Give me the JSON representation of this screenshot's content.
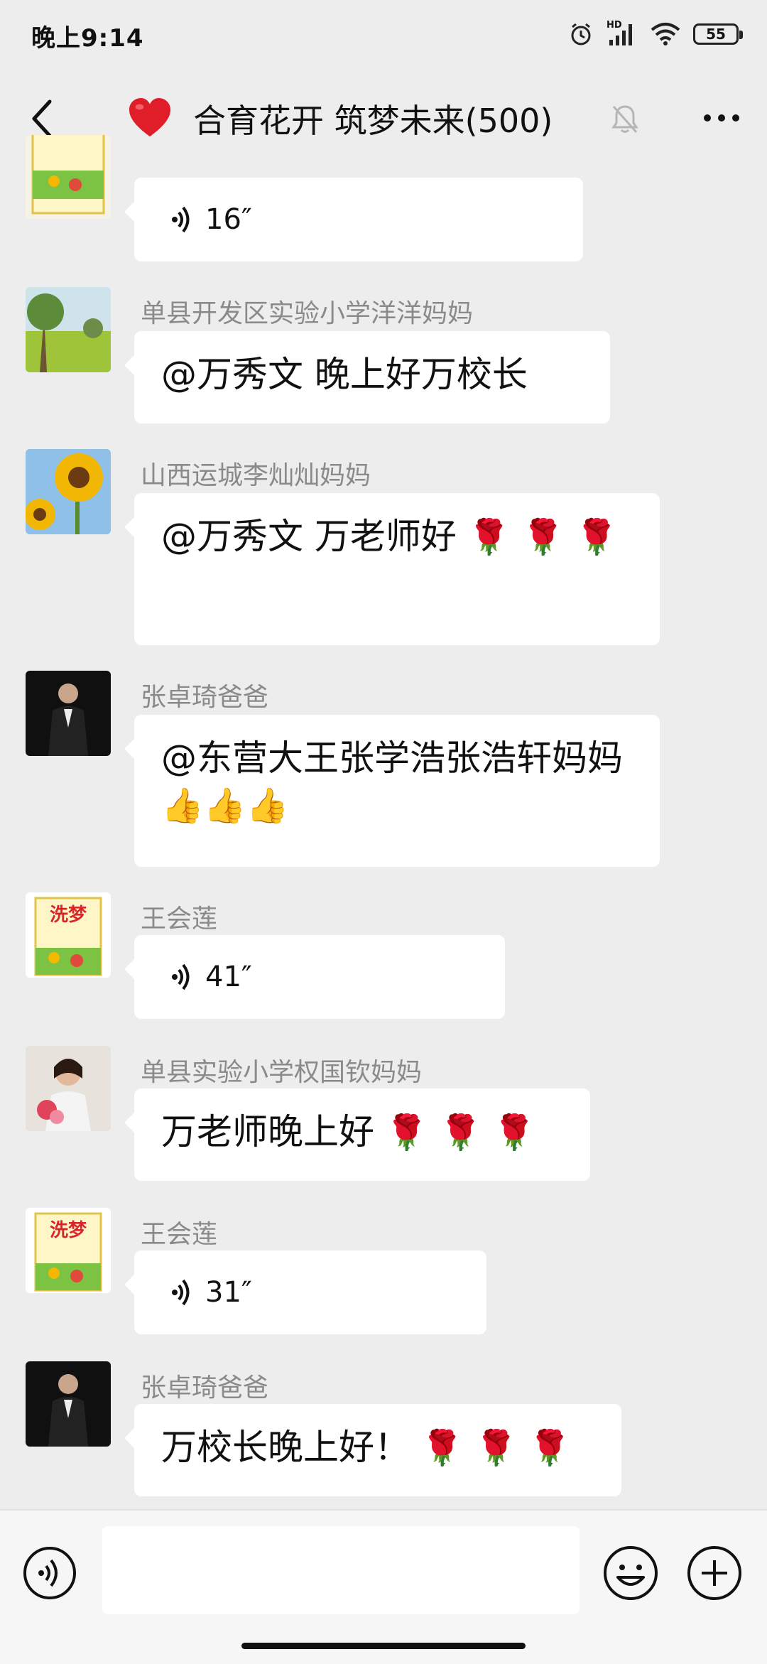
{
  "status_bar": {
    "time": "晚上9:14",
    "network": "HD",
    "battery": "55",
    "icons": [
      "alarm-icon",
      "signal-icon",
      "wifi-icon",
      "battery-icon"
    ]
  },
  "header": {
    "title": "合育花开 筑梦未来(500)",
    "emoji": "heart",
    "icons": [
      "back-icon",
      "mute-bell-icon",
      "more-icon"
    ]
  },
  "messages": [
    {
      "type": "voice",
      "duration": "16″",
      "avatar": "milk-powder-package"
    },
    {
      "type": "text",
      "sender": "单县开发区实验小学洋洋妈妈",
      "text": "@万秀文  晚上好万校长",
      "avatar": "green-field"
    },
    {
      "type": "text",
      "sender": "山西运城李灿灿妈妈",
      "text": "@万秀文  万老师好",
      "emoji": "rose",
      "emoji_count": 3,
      "avatar": "sunflower"
    },
    {
      "type": "text",
      "sender": "张卓琦爸爸",
      "text": "@东营大王张学浩张浩轩妈妈",
      "emoji": "thumbs-up",
      "emoji_count": 3,
      "avatar": "man-in-suit"
    },
    {
      "type": "voice",
      "sender": "王会莲",
      "duration": "41″",
      "avatar": "milk-powder-package"
    },
    {
      "type": "text",
      "sender": "单县实验小学权国钦妈妈",
      "text": "万老师晚上好",
      "emoji": "rose",
      "emoji_count": 3,
      "avatar": "woman-with-flowers"
    },
    {
      "type": "voice",
      "sender": "王会莲",
      "duration": "31″",
      "avatar": "milk-powder-package"
    },
    {
      "type": "text",
      "sender": "张卓琦爸爸",
      "text": "万校长晚上好！",
      "emoji": "rose",
      "emoji_count": 3,
      "avatar": "man-in-suit"
    }
  ],
  "input_bar": {
    "icons": [
      "voice-input-icon",
      "emoji-icon",
      "plus-icon"
    ]
  },
  "colors": {
    "background": "#ededed",
    "bubble": "#ffffff",
    "sender_name": "#8a8a8a"
  }
}
